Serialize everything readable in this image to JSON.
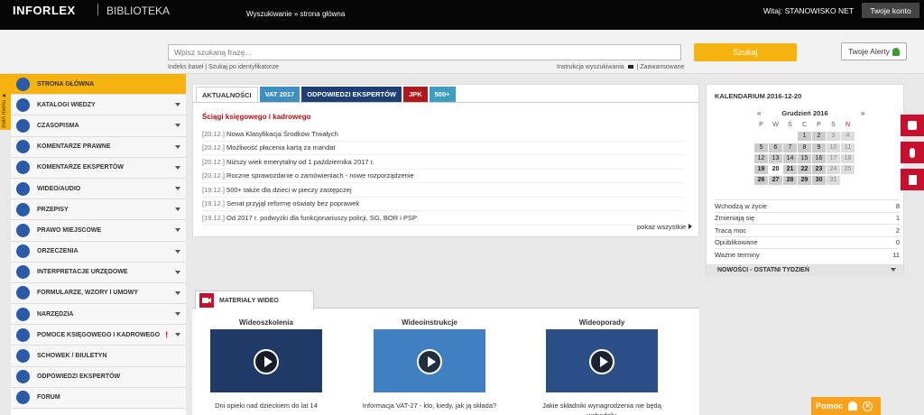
{
  "header": {
    "logo": "INFORLEX",
    "app_name": "BIBLIOTEKA",
    "breadcrumb": "Wyszukiwanie » strona główna",
    "welcome": "Witaj: STANOWISKO NET",
    "account_button": "Twoje konto"
  },
  "search": {
    "placeholder": "Wpisz szukaną frazę...",
    "button": "Szukaj",
    "alerts_button": "Twoje Alerty",
    "links_left": "Indeks haseł  |  Szukaj po identyfikatorze",
    "links_right_1": "Instrukcja wyszukiwania",
    "links_right_2": "| Zaawansowane"
  },
  "sidebar": {
    "collapse_label": "zwiń menu ▲",
    "items": [
      {
        "label": "STRONA GŁÓWNA",
        "active": true,
        "icon": "search-icon"
      },
      {
        "label": "KATALOGI WIEDZY",
        "icon": "catalog-icon"
      },
      {
        "label": "CZASOPISMA",
        "icon": "magazine-icon"
      },
      {
        "label": "KOMENTARZE PRAWNE",
        "icon": "comment-icon"
      },
      {
        "label": "KOMENTARZE EKSPERTÓW",
        "icon": "expert-icon"
      },
      {
        "label": "WIDEO/AUDIO",
        "icon": "video-icon"
      },
      {
        "label": "PRZEPISY",
        "icon": "paragraph-icon"
      },
      {
        "label": "PRAWO MIEJSCOWE",
        "icon": "shield-icon"
      },
      {
        "label": "ORZECZENIA",
        "icon": "scales-icon"
      },
      {
        "label": "INTERPRETACJE URZĘDOWE",
        "icon": "building-icon"
      },
      {
        "label": "FORMULARZE, WZORY I UMOWY",
        "icon": "form-icon"
      },
      {
        "label": "NARZĘDZIA",
        "icon": "pencil-icon"
      },
      {
        "label": "POMOCE KSIĘGOWEGO I KADROWEGO",
        "icon": "calculator-icon",
        "alert": "!"
      },
      {
        "label": "SCHOWEK / BIULETYN",
        "icon": "clipboard-icon"
      },
      {
        "label": "ODPOWIEDZI EKSPERTÓW",
        "icon": "chat-icon"
      },
      {
        "label": "FORUM",
        "icon": "forum-icon"
      }
    ]
  },
  "news": {
    "tabs": [
      {
        "label": "AKTUALNOŚCI",
        "color": "#ffffff",
        "active": true
      },
      {
        "label": "VAT 2017",
        "color": "#3c8fc0"
      },
      {
        "label": "ODPOWIEDZI EKSPERTÓW",
        "color": "#1d3f73"
      },
      {
        "label": "JPK",
        "color": "#b0181b"
      },
      {
        "label": "500+",
        "color": "#3c9fc0"
      }
    ],
    "heading": "Ściągi księgowego i kadrowego",
    "items": [
      {
        "date": "[20.12.]",
        "text": "Nowa Klasyfikacja Środków Trwałych"
      },
      {
        "date": "[20.12.]",
        "text": "Możliwość płacenia kartą za mandat"
      },
      {
        "date": "[20.12.]",
        "text": "Niższy wiek emerytalny od 1 października 2017 r."
      },
      {
        "date": "[20.12.]",
        "text": "Roczne sprawozdanie o zamówieniach - nowe rozporządzenie"
      },
      {
        "date": "[19.12.]",
        "text": "500+ także dla dzieci w pieczy zastępczej"
      },
      {
        "date": "[19.12.]",
        "text": "Senat przyjął reformę oświaty bez poprawek"
      },
      {
        "date": "[19.12.]",
        "text": "Od 2017 r. podwyżki dla funkcjonariuszy policji, SG, BOR i PSP"
      }
    ],
    "show_all": "pokaż wszystkie"
  },
  "video": {
    "tab_label": "MATERIAŁY WIDEO",
    "cards": [
      {
        "title": "Wideoszkolenia",
        "caption": "Dni opieki nad dzieckiem do lat 14",
        "thumb_color": "#1f3a66"
      },
      {
        "title": "Wideoinstrukcje",
        "caption": "Informacja VAT-27 - kto, kiedy, jak ją składa?",
        "thumb_color": "#3f7fc2"
      },
      {
        "title": "Wideoporady",
        "caption": "Jakie składniki wynagrodzenia nie będą wchodziły",
        "thumb_color": "#2c4f88"
      }
    ]
  },
  "calendar": {
    "title": "KALENDARIUM 2016-12-20",
    "month": "Grudzień 2016",
    "prev": "«",
    "next": "»",
    "day_headers": [
      "P",
      "W",
      "Ś",
      "C",
      "P",
      "S",
      "N"
    ],
    "weeks": [
      [
        "",
        "",
        "",
        "1",
        "2",
        "3",
        "4"
      ],
      [
        "5",
        "6",
        "7",
        "8",
        "9",
        "10",
        "11"
      ],
      [
        "12",
        "13",
        "14",
        "15",
        "16",
        "17",
        "18"
      ],
      [
        "19",
        "20",
        "21",
        "22",
        "23",
        "24",
        "25"
      ],
      [
        "26",
        "27",
        "28",
        "29",
        "30",
        "31",
        ""
      ]
    ],
    "today": "20",
    "stats": [
      {
        "label": "Wchodzą w życie",
        "value": "8"
      },
      {
        "label": "Zmieniają się",
        "value": "1"
      },
      {
        "label": "Tracą moc",
        "value": "2"
      },
      {
        "label": "Opublikowane",
        "value": "0"
      },
      {
        "label": "Ważne terminy",
        "value": "11"
      }
    ],
    "news_week": "NOWOŚCI - OSTATNI TYDZIEŃ"
  },
  "help": {
    "label": "Pomoc"
  }
}
